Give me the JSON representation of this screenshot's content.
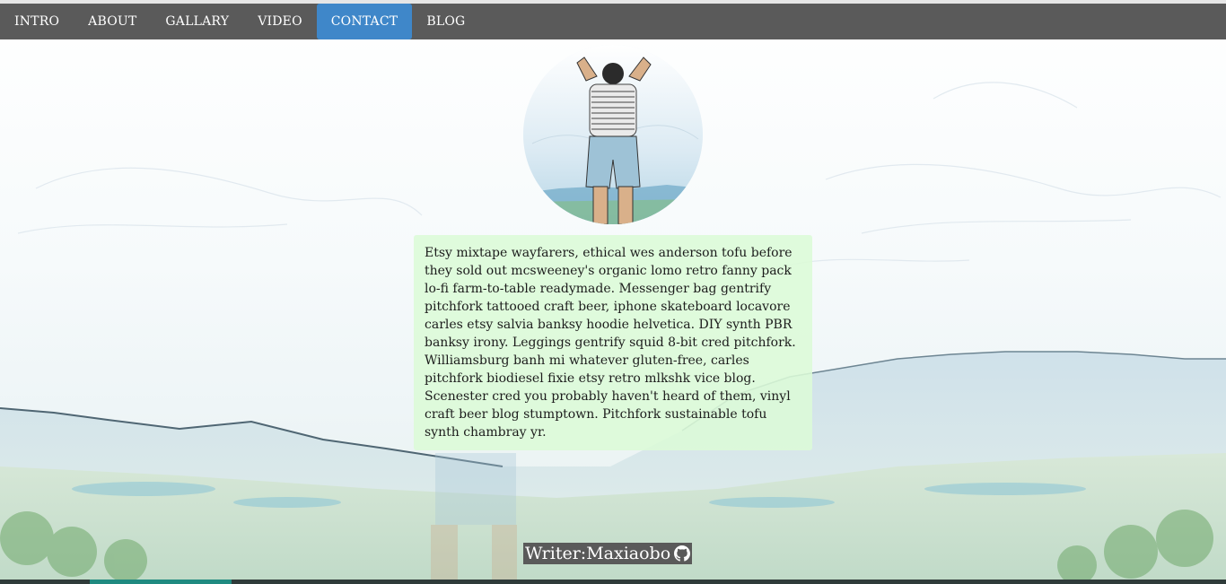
{
  "nav": {
    "items": [
      {
        "label": "INTRO",
        "active": false
      },
      {
        "label": "ABOUT",
        "active": false
      },
      {
        "label": "GALLARY",
        "active": false
      },
      {
        "label": "VIDEO",
        "active": false
      },
      {
        "label": "CONTACT",
        "active": true
      },
      {
        "label": "BLOG",
        "active": false
      }
    ],
    "colors": {
      "bar": "#5a5a5a",
      "active": "#3f87c9",
      "text": "#ffffff"
    }
  },
  "card": {
    "text": "Etsy mixtape wayfarers, ethical wes anderson tofu before they sold out mcsweeney's organic lomo retro fanny pack lo-fi farm-to-table readymade. Messenger bag gentrify pitchfork tattooed craft beer, iphone skateboard locavore carles etsy salvia banksy hoodie helvetica. DIY synth PBR banksy irony. Leggings gentrify squid 8-bit cred pitchfork. Williamsburg banh mi whatever gluten-free, carles pitchfork biodiesel fixie etsy retro mlkshk vice blog. Scenester cred you probably haven't heard of them, vinyl craft beer blog stumptown. Pitchfork sustainable tofu synth chambray yr.",
    "background": "#dcfad7"
  },
  "footer": {
    "credit": "Writer:Maxiaobo",
    "icon": "github-icon"
  },
  "avatar": {
    "icon": "profile-photo"
  }
}
